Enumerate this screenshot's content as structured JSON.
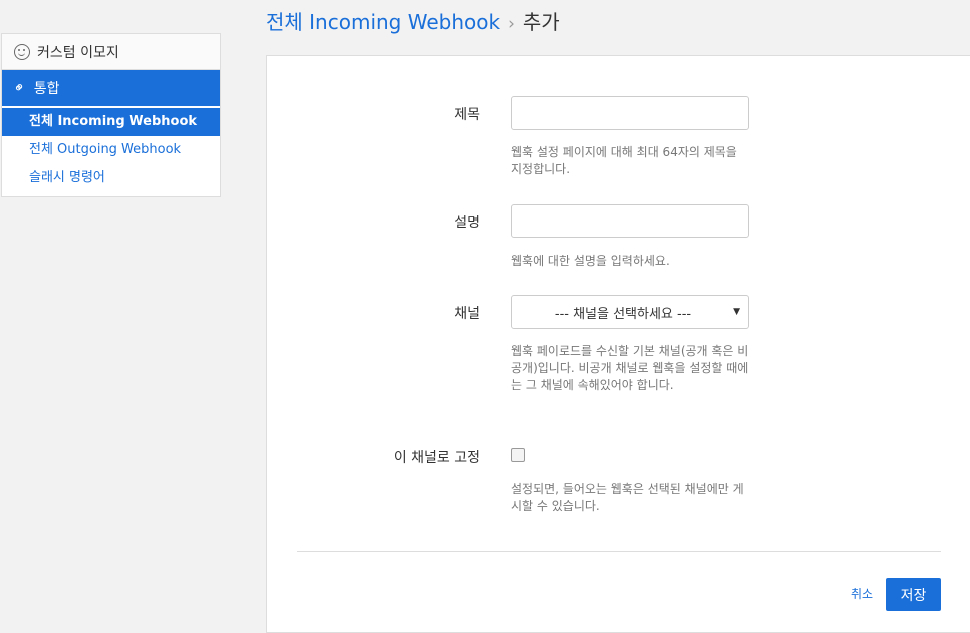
{
  "sidebar": {
    "custom_emoji": "커스텀 이모지",
    "integrations": "통합",
    "items": [
      {
        "label": "전체 Incoming Webhook",
        "active": true
      },
      {
        "label": "전체 Outgoing Webhook",
        "active": false
      },
      {
        "label": "슬래시 명령어",
        "active": false
      }
    ]
  },
  "breadcrumb": {
    "parent": "전체 Incoming Webhook",
    "separator": "›",
    "current": "추가"
  },
  "form": {
    "title": {
      "label": "제목",
      "value": "",
      "help": "웹훅 설정 페이지에 대해 최대 64자의 제목을 지정합니다."
    },
    "description": {
      "label": "설명",
      "value": "",
      "help": "웹훅에 대한 설명을 입력하세요."
    },
    "channel": {
      "label": "채널",
      "selected": "--- 채널을 선택하세요 ---",
      "help": "웹훅 페이로드를 수신할 기본 채널(공개 혹은 비공개)입니다. 비공개 채널로 웹훅을 설정할 때에는 그 채널에 속해있어야 합니다."
    },
    "lock_channel": {
      "label": "이 채널로 고정",
      "checked": false,
      "help": "설정되면, 들어오는 웹훅은 선택된 채널에만 게시할 수 있습니다."
    }
  },
  "actions": {
    "cancel": "취소",
    "save": "저장"
  },
  "colors": {
    "accent": "#1a6fd9"
  }
}
